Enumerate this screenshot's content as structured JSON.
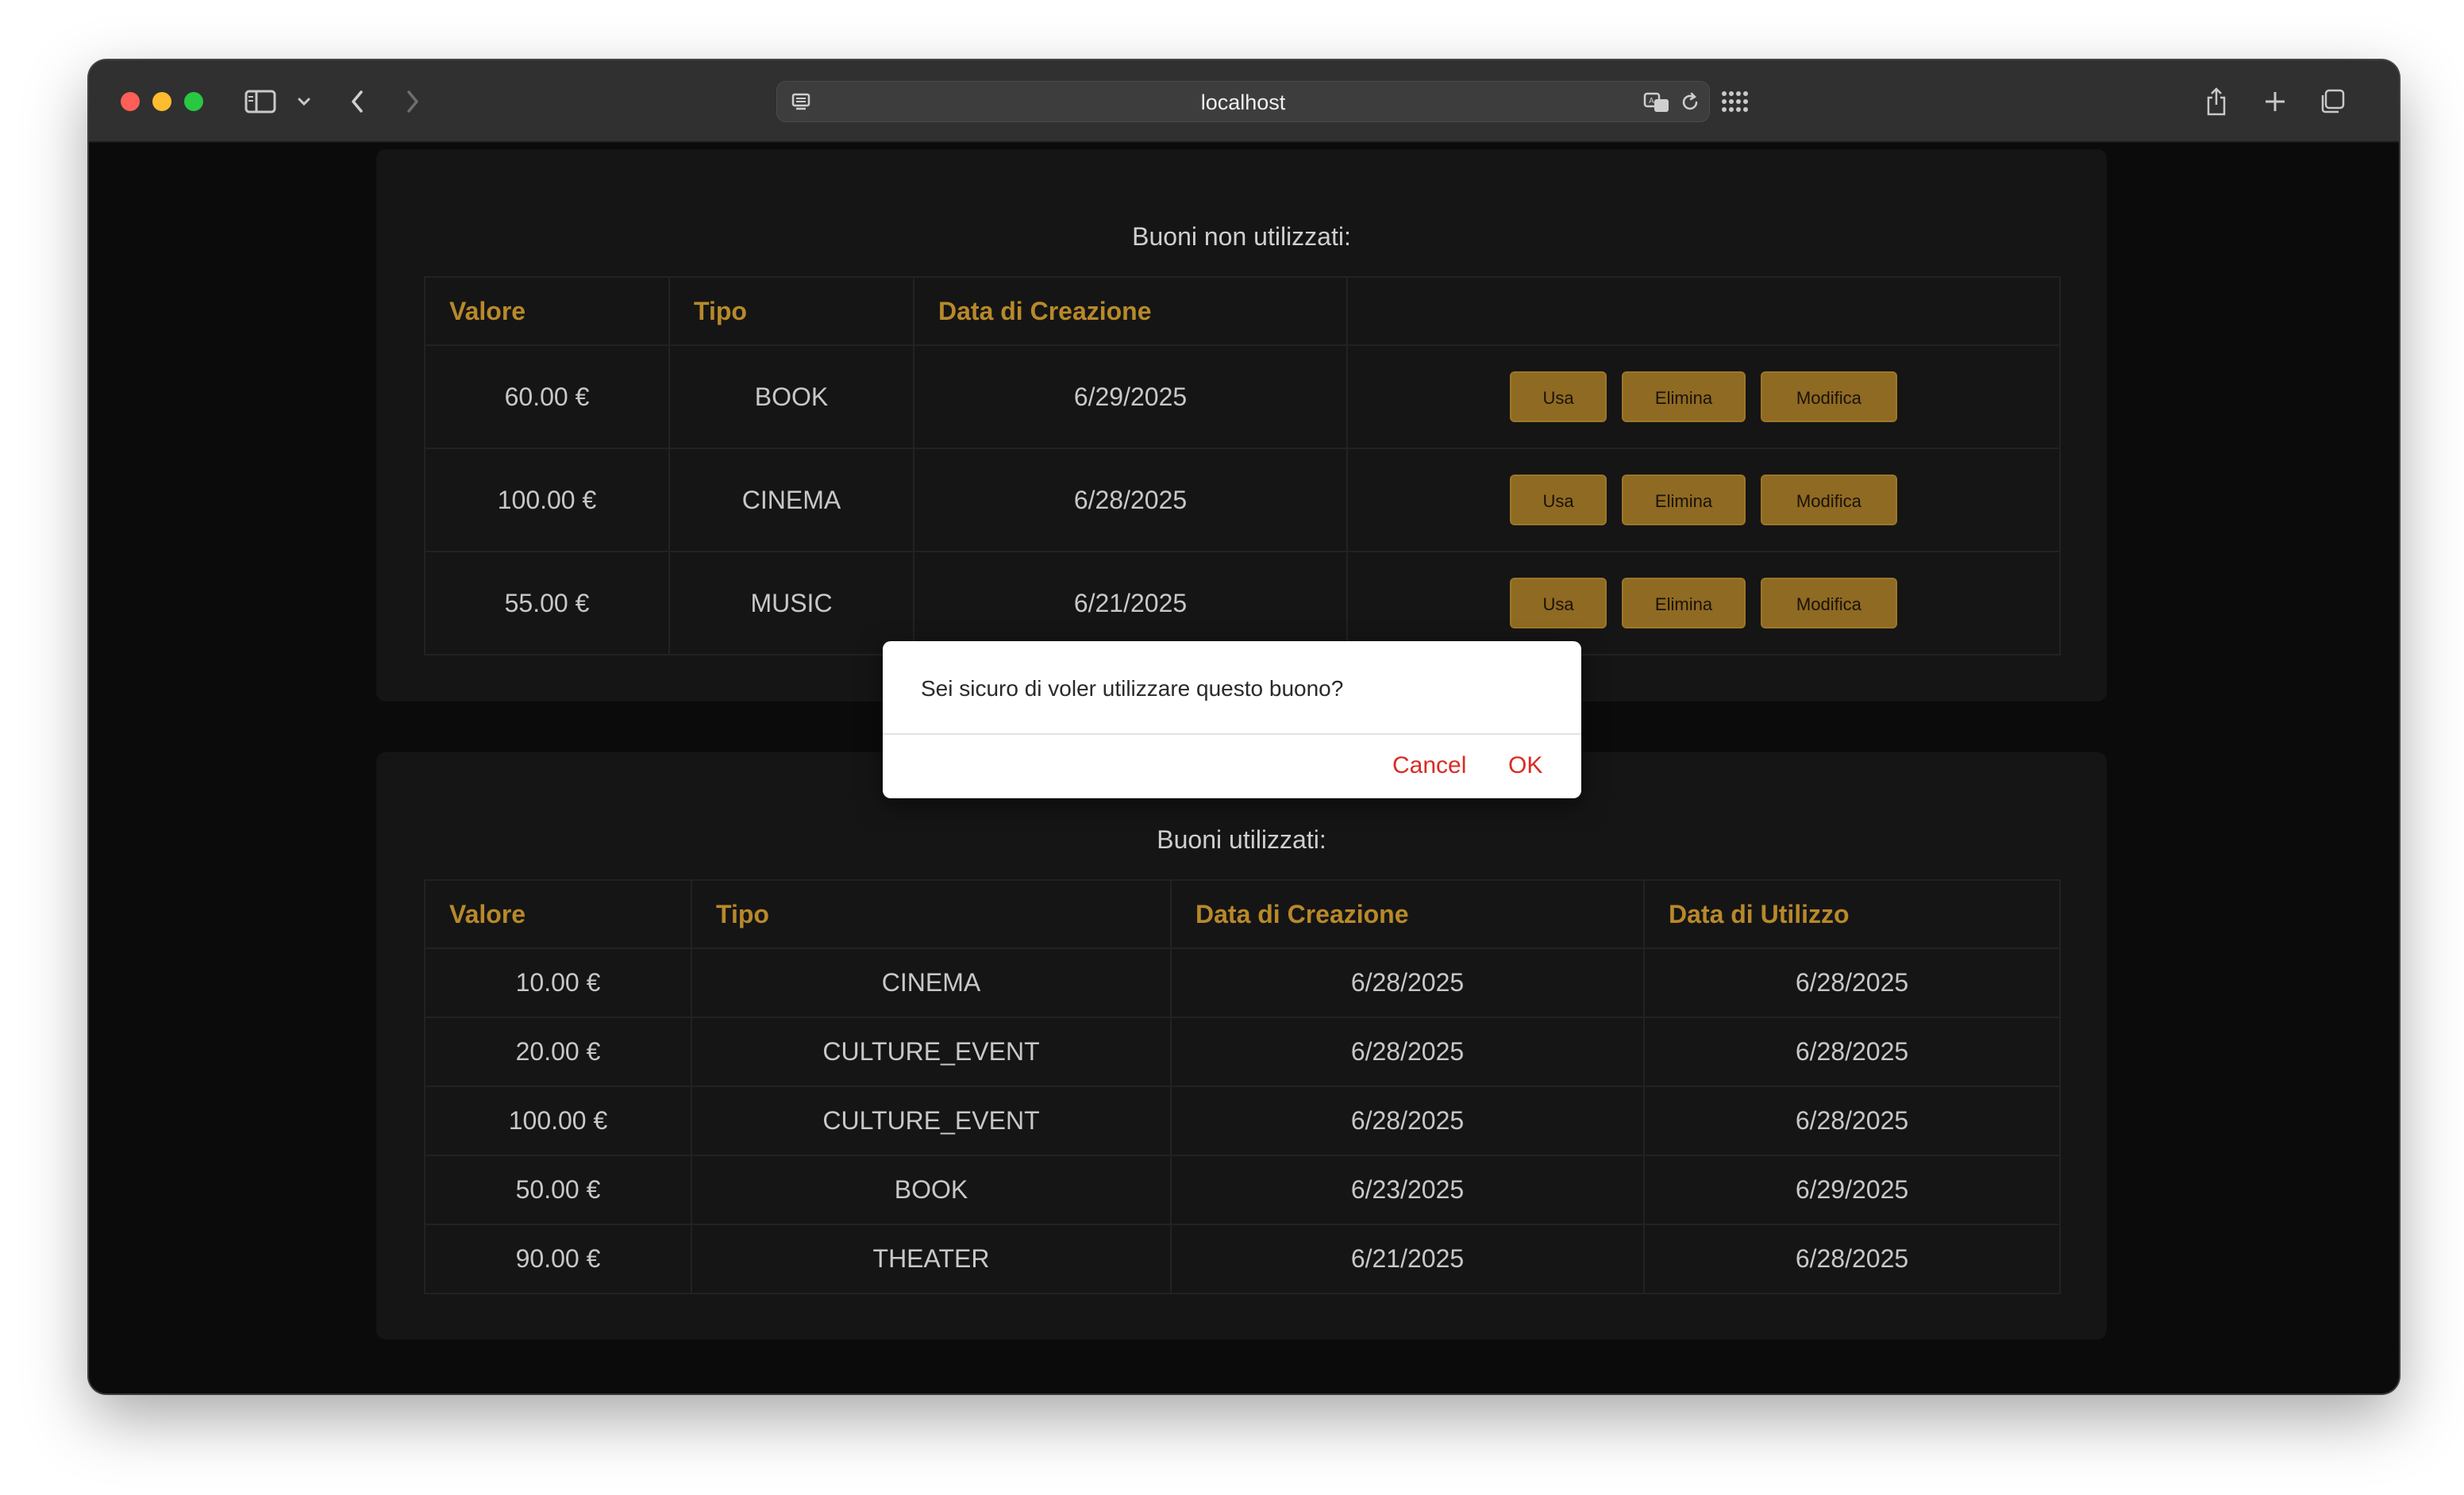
{
  "browser": {
    "url": "localhost"
  },
  "unused": {
    "title": "Buoni non utilizzati:",
    "headers": [
      "Valore",
      "Tipo",
      "Data di Creazione",
      ""
    ],
    "rows": [
      {
        "valore": "60.00 €",
        "tipo": "BOOK",
        "data": "6/29/2025"
      },
      {
        "valore": "100.00 €",
        "tipo": "CINEMA",
        "data": "6/28/2025"
      },
      {
        "valore": "55.00 €",
        "tipo": "MUSIC",
        "data": "6/21/2025"
      }
    ],
    "actions": {
      "use": "Usa",
      "delete": "Elimina",
      "edit": "Modifica"
    }
  },
  "used": {
    "title": "Buoni utilizzati:",
    "headers": [
      "Valore",
      "Tipo",
      "Data di Creazione",
      "Data di Utilizzo"
    ],
    "rows": [
      {
        "valore": "10.00 €",
        "tipo": "CINEMA",
        "creazione": "6/28/2025",
        "utilizzo": "6/28/2025"
      },
      {
        "valore": "20.00 €",
        "tipo": "CULTURE_EVENT",
        "creazione": "6/28/2025",
        "utilizzo": "6/28/2025"
      },
      {
        "valore": "100.00 €",
        "tipo": "CULTURE_EVENT",
        "creazione": "6/28/2025",
        "utilizzo": "6/28/2025"
      },
      {
        "valore": "50.00 €",
        "tipo": "BOOK",
        "creazione": "6/23/2025",
        "utilizzo": "6/29/2025"
      },
      {
        "valore": "90.00 €",
        "tipo": "THEATER",
        "creazione": "6/21/2025",
        "utilizzo": "6/28/2025"
      }
    ]
  },
  "dialog": {
    "message": "Sei sicuro di voler utilizzare questo buono?",
    "cancel": "Cancel",
    "ok": "OK"
  },
  "colors": {
    "accent_gold": "#b8892a",
    "button_gold": "#8f6a22",
    "dialog_button_red": "#d92b22"
  }
}
